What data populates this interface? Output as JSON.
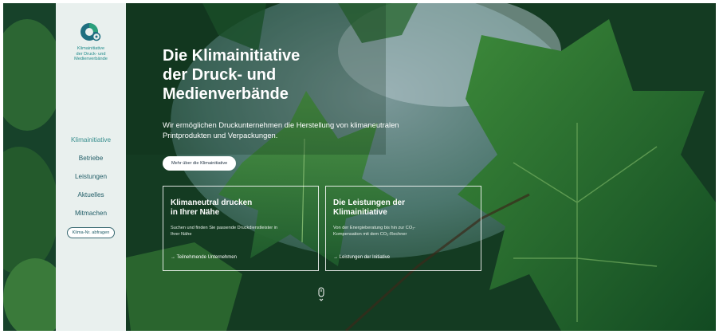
{
  "brand": {
    "logo_lines": [
      "Klimainitiative",
      "der Druck- und",
      "Medienverbände"
    ],
    "accent": "#1f8a8a"
  },
  "sidebar": {
    "items": [
      {
        "label": "Klimainitiative",
        "active": true
      },
      {
        "label": "Betriebe"
      },
      {
        "label": "Leistungen"
      },
      {
        "label": "Aktuelles"
      },
      {
        "label": "Mitmachen"
      }
    ],
    "cta_label": "Klima-Nr. abfragen"
  },
  "hero": {
    "title_lines": [
      "Die Klimainitiative",
      "der Druck- und",
      "Medienverbände"
    ],
    "subtitle_lines": [
      "Wir ermöglichen Druckunternehmen die Herstellung von klimaneutralen",
      "Printprodukten und Verpackungen."
    ],
    "cta_label": "Mehr über die Klimainitiative"
  },
  "cards": [
    {
      "title_lines": [
        "Klimaneutral drucken",
        "in Ihrer Nähe"
      ],
      "text_lines": [
        "Suchen und finden Sie passende Druckdienstleister in",
        "Ihrer Nähe"
      ],
      "link": "Teilnehmende Unternehmen"
    },
    {
      "title_lines": [
        "Die Leistungen der",
        "Klimainitiative"
      ],
      "text_lines": [
        "Von der Energieberatung bis hin zur CO₂-",
        "Kompensation mit dem CO₂-Rechner"
      ],
      "link": "Leistungen der Initiative"
    }
  ],
  "icons": {
    "scroll": "mouse-scroll-icon",
    "arrow": "arrow-right-icon",
    "logo": "climate-initiative-logo-icon"
  }
}
